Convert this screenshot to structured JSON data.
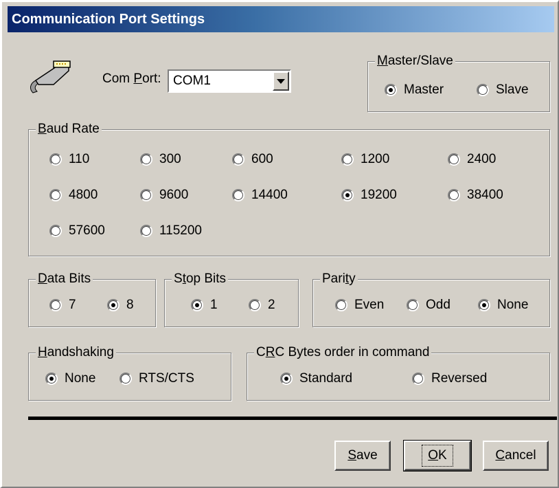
{
  "window": {
    "title": "Communication Port Settings"
  },
  "comport": {
    "label_pre": "Com ",
    "label_key": "P",
    "label_post": "ort:",
    "value": "COM1"
  },
  "master_slave": {
    "legend_key": "M",
    "legend_rest": "aster/Slave",
    "options": [
      {
        "label": "Master",
        "selected": true
      },
      {
        "label": "Slave",
        "selected": false
      }
    ]
  },
  "baud": {
    "legend_key": "B",
    "legend_rest": "aud Rate",
    "options": [
      {
        "label": "110",
        "selected": false
      },
      {
        "label": "300",
        "selected": false
      },
      {
        "label": "600",
        "selected": false
      },
      {
        "label": "1200",
        "selected": false
      },
      {
        "label": "2400",
        "selected": false
      },
      {
        "label": "4800",
        "selected": false
      },
      {
        "label": "9600",
        "selected": false
      },
      {
        "label": "14400",
        "selected": false
      },
      {
        "label": "19200",
        "selected": true
      },
      {
        "label": "38400",
        "selected": false
      },
      {
        "label": "57600",
        "selected": false
      },
      {
        "label": "115200",
        "selected": false
      }
    ]
  },
  "data_bits": {
    "legend_key": "D",
    "legend_rest": "ata Bits",
    "options": [
      {
        "label": "7",
        "selected": false
      },
      {
        "label": "8",
        "selected": true
      }
    ]
  },
  "stop_bits": {
    "legend_pre": "S",
    "legend_key": "t",
    "legend_rest": "op Bits",
    "options": [
      {
        "label": "1",
        "selected": true
      },
      {
        "label": "2",
        "selected": false
      }
    ]
  },
  "parity": {
    "legend_pre": "Pari",
    "legend_key": "t",
    "legend_rest": "y",
    "options": [
      {
        "label": "Even",
        "selected": false
      },
      {
        "label": "Odd",
        "selected": false
      },
      {
        "label": "None",
        "selected": true
      }
    ]
  },
  "handshaking": {
    "legend_key": "H",
    "legend_rest": "andshaking",
    "options": [
      {
        "label": "None",
        "selected": true
      },
      {
        "label": "RTS/CTS",
        "selected": false
      }
    ]
  },
  "crc": {
    "legend_pre": "C",
    "legend_key": "R",
    "legend_rest": "C Bytes order in command",
    "options": [
      {
        "label": "Standard",
        "selected": true
      },
      {
        "label": "Reversed",
        "selected": false
      }
    ]
  },
  "buttons": {
    "save": {
      "key": "S",
      "rest": "ave"
    },
    "ok": {
      "key": "O",
      "rest": "K"
    },
    "cancel": {
      "key": "C",
      "rest": "ancel"
    }
  },
  "icons": {
    "port": "serial-cable-icon",
    "dropdown": "chevron-down-icon"
  }
}
